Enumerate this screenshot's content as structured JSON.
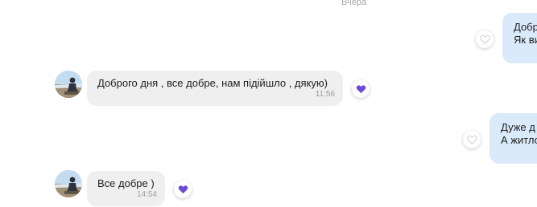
{
  "chat": {
    "date_separator": "Вчера",
    "messages": [
      {
        "direction": "outgoing",
        "lines": [
          "Добр",
          "Як ви"
        ],
        "liked": false
      },
      {
        "direction": "incoming",
        "text": "Доброго дня , все добре, нам підійшло , дякую)",
        "time": "11:56",
        "liked": true
      },
      {
        "direction": "outgoing",
        "lines": [
          "Дуже д",
          "А житло"
        ],
        "liked": false
      },
      {
        "direction": "incoming",
        "text": "Все добре )",
        "time": "14:54",
        "liked": true
      }
    ]
  },
  "colors": {
    "incoming_bubble": "#efefef",
    "outgoing_bubble": "#dbeafb",
    "heart_liked": "#6a4ad6",
    "heart_unliked": "#d0d0d0"
  },
  "icons": {
    "reaction": "heart-icon",
    "avatar": "user-avatar-photo"
  }
}
